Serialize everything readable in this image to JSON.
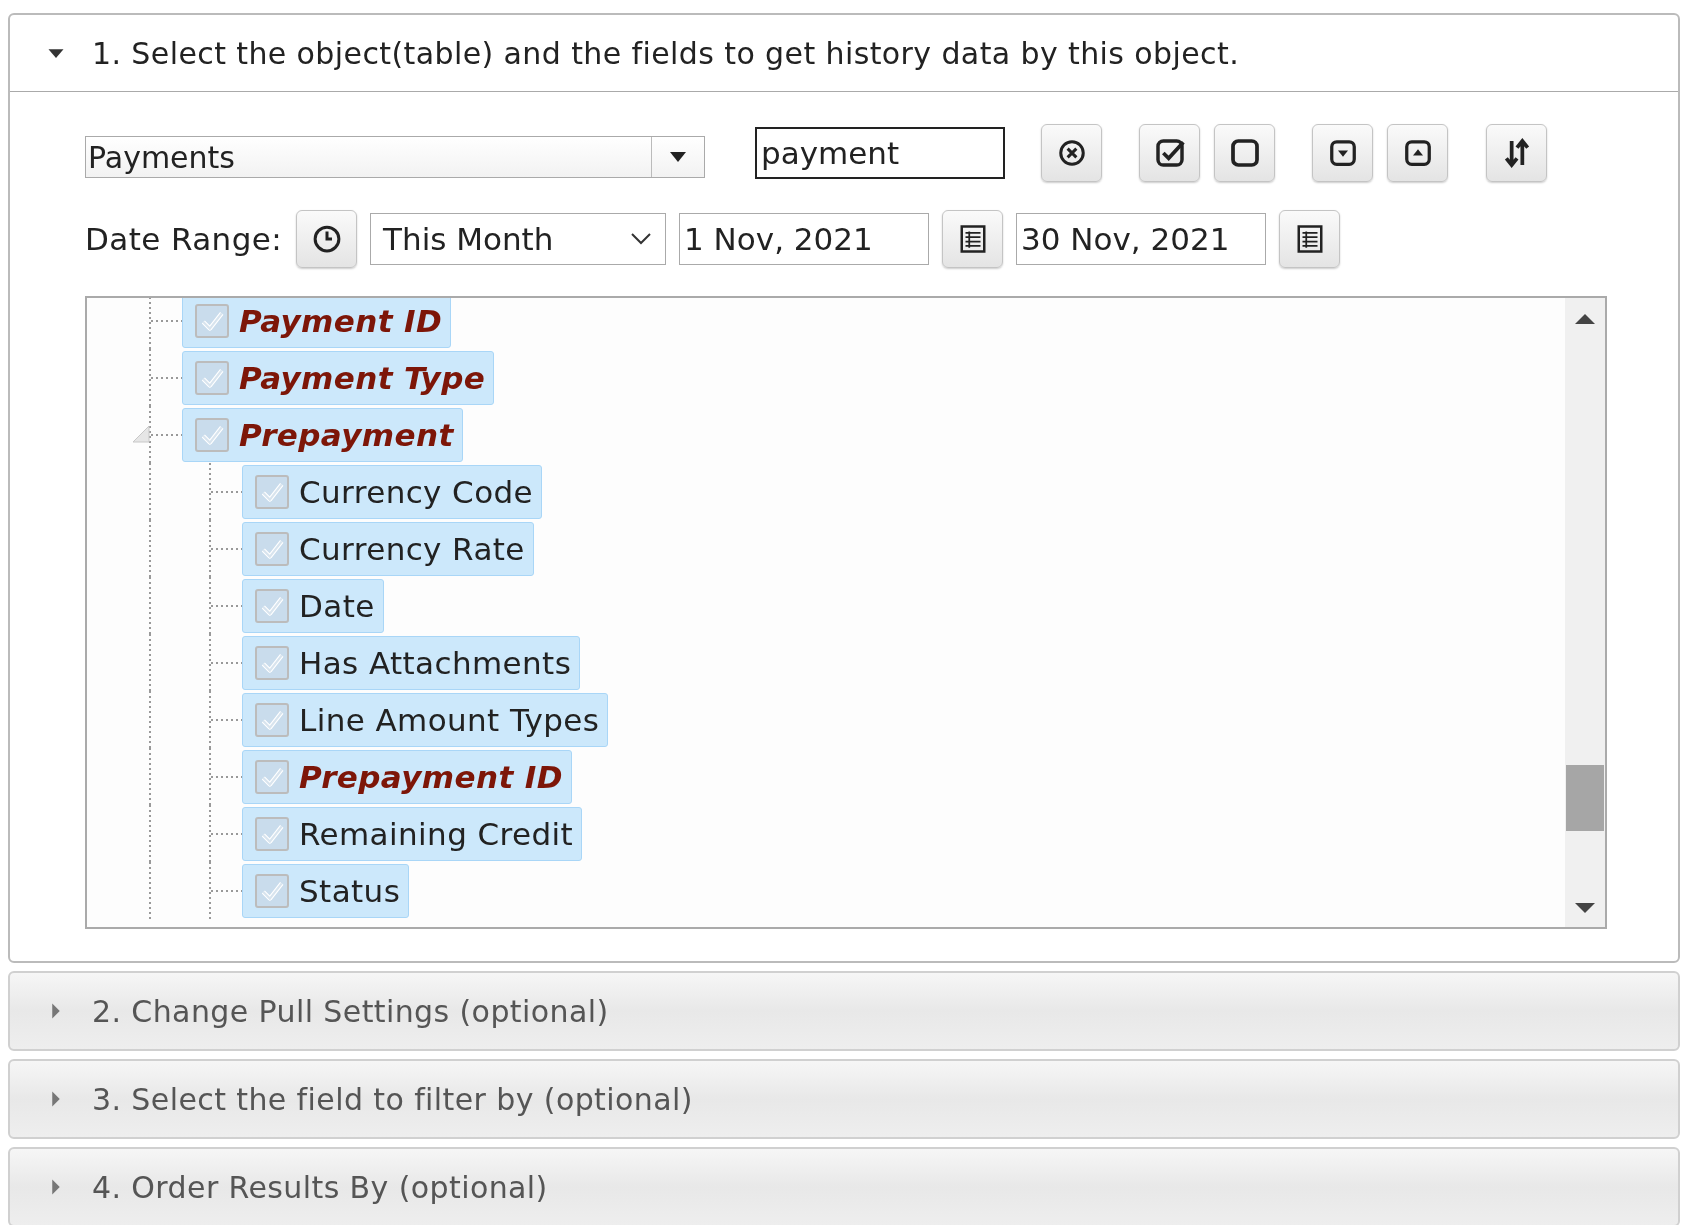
{
  "sections": [
    {
      "title": "1. Select the object(table) and the fields to get history data by this object.",
      "expanded": true,
      "object_select": {
        "value": "Payments"
      },
      "search": {
        "value": "payment"
      },
      "date_range": {
        "label": "Date Range:",
        "preset": "This Month",
        "from": "1 Nov, 2021",
        "to": "30 Nov, 2021"
      },
      "field_tree": [
        {
          "label": "Payment ID",
          "checked": true,
          "selected": true,
          "key_field": true
        },
        {
          "label": "Payment Type",
          "checked": true,
          "selected": true,
          "key_field": true
        },
        {
          "label": "Prepayment",
          "checked": true,
          "selected": true,
          "key_field": true,
          "expanded": true,
          "children": [
            {
              "label": "Currency Code",
              "checked": true,
              "selected": true,
              "key_field": false
            },
            {
              "label": "Currency Rate",
              "checked": true,
              "selected": true,
              "key_field": false
            },
            {
              "label": "Date",
              "checked": true,
              "selected": true,
              "key_field": false
            },
            {
              "label": "Has Attachments",
              "checked": true,
              "selected": true,
              "key_field": false
            },
            {
              "label": "Line Amount Types",
              "checked": true,
              "selected": true,
              "key_field": false
            },
            {
              "label": "Prepayment ID",
              "checked": true,
              "selected": true,
              "key_field": true
            },
            {
              "label": "Remaining Credit",
              "checked": true,
              "selected": true,
              "key_field": false
            },
            {
              "label": "Status",
              "checked": true,
              "selected": true,
              "key_field": false
            }
          ]
        }
      ]
    },
    {
      "title": "2. Change Pull Settings (optional)",
      "expanded": false
    },
    {
      "title": "3. Select the field to filter by (optional)",
      "expanded": false
    },
    {
      "title": "4. Order Results By (optional)",
      "expanded": false
    }
  ]
}
